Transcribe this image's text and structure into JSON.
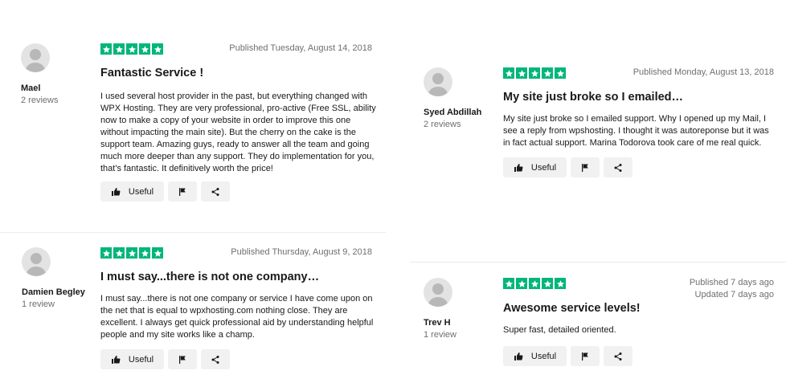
{
  "reviews": [
    {
      "reviewer": {
        "name": "Mael",
        "count": "2 reviews",
        "avatar_icon": "user-avatar-icon"
      },
      "rating": 5,
      "date_lines": [
        "Published Tuesday, August 14, 2018"
      ],
      "title": "Fantastic Service !",
      "body_lines": [
        "I used several host provider in the past, but everything changed with",
        "WPX Hosting. They are very professional, pro-active (Free SSL, ability",
        "now to make a copy of your website in order to improve this one",
        "without impacting the main site). But the cherry on the cake is the",
        "support team. Amazing guys, ready to answer all the team and going",
        "much more deeper than any support. They do implementation for you,",
        "that's fantastic. It definitively worth the price!"
      ],
      "actions": {
        "useful_label": "Useful",
        "useful_icon": "thumbs-up-icon",
        "flag_icon": "flag-icon",
        "share_icon": "share-icon"
      }
    },
    {
      "reviewer": {
        "name": "Syed Abdillah",
        "count": "2 reviews",
        "avatar_icon": "user-avatar-icon"
      },
      "rating": 5,
      "date_lines": [
        "Published Monday, August 13, 2018"
      ],
      "title": "My site just broke so I emailed…",
      "body_lines": [
        "My site just broke so I emailed support. Why I opened up my Mail, I",
        "see a reply from wpshosting. I thought it was autoreponse but it was",
        "in fact actual support. Marina Todorova took care of me real quick."
      ],
      "actions": {
        "useful_label": "Useful",
        "useful_icon": "thumbs-up-icon",
        "flag_icon": "flag-icon",
        "share_icon": "share-icon"
      }
    },
    {
      "reviewer": {
        "name": "Damien Begley",
        "count": "1 review",
        "avatar_icon": "user-avatar-icon"
      },
      "rating": 5,
      "date_lines": [
        "Published Thursday, August 9, 2018"
      ],
      "title": "I must say...there is not one company…",
      "body_lines": [
        "I must say...there is not one company or service I have come upon on",
        "the net that is equal to wpxhosting.com nothing close. They are",
        "excellent. I always get quick professional aid by understanding helpful",
        "people and my site works like a champ."
      ],
      "actions": {
        "useful_label": "Useful",
        "useful_icon": "thumbs-up-icon",
        "flag_icon": "flag-icon",
        "share_icon": "share-icon"
      }
    },
    {
      "reviewer": {
        "name": "Trev H",
        "count": "1 review",
        "avatar_icon": "user-avatar-icon"
      },
      "rating": 5,
      "date_lines": [
        "Published 7 days ago",
        "Updated 7 days ago"
      ],
      "title": "Awesome service levels!",
      "body_lines": [
        "Super fast, detailed oriented."
      ],
      "actions": {
        "useful_label": "Useful",
        "useful_icon": "thumbs-up-icon",
        "flag_icon": "flag-icon",
        "share_icon": "share-icon"
      }
    }
  ],
  "colors": {
    "star": "#00b67a",
    "button_bg": "#f1f1f1",
    "muted_text": "#6f6f6f",
    "avatar_bg": "#e3e3e3"
  }
}
